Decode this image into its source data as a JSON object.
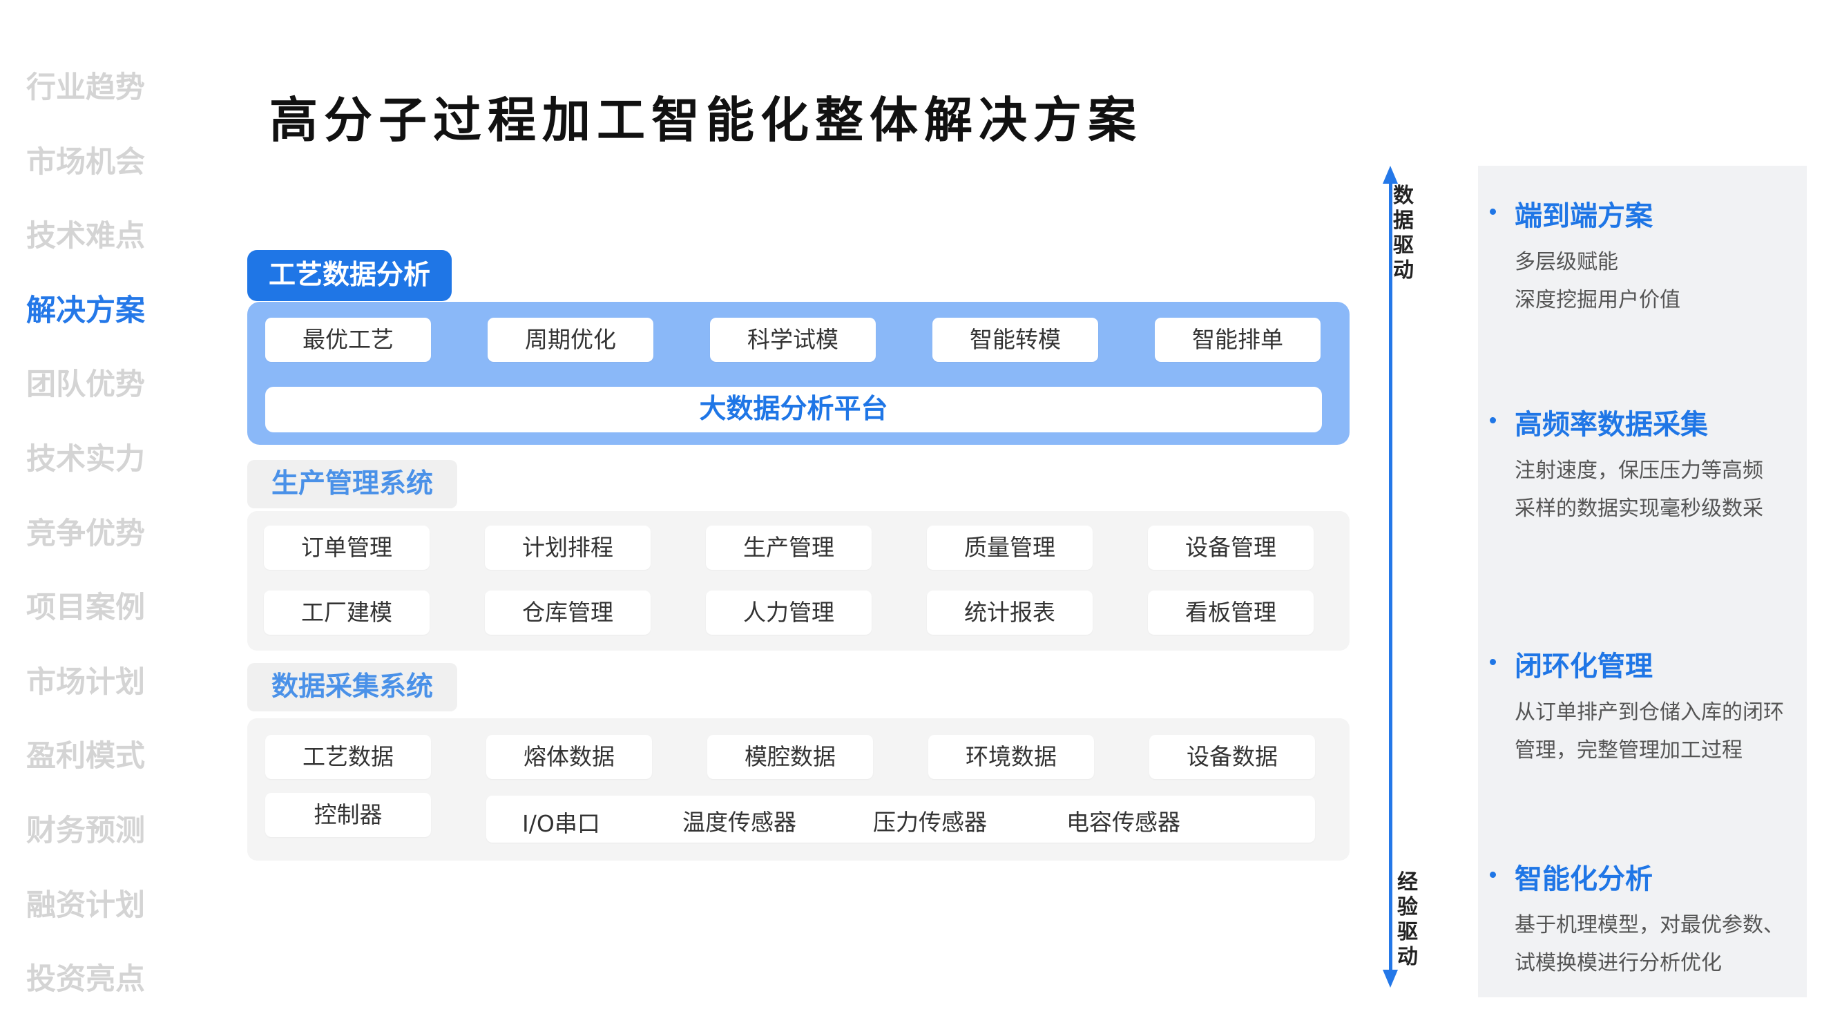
{
  "nav": {
    "items": [
      {
        "label": "行业趋势",
        "active": false
      },
      {
        "label": "市场机会",
        "active": false
      },
      {
        "label": "技术难点",
        "active": false
      },
      {
        "label": "解决方案",
        "active": true
      },
      {
        "label": "团队优势",
        "active": false
      },
      {
        "label": "技术实力",
        "active": false
      },
      {
        "label": "竞争优势",
        "active": false
      },
      {
        "label": "项目案例",
        "active": false
      },
      {
        "label": "市场计划",
        "active": false
      },
      {
        "label": "盈利模式",
        "active": false
      },
      {
        "label": "财务预测",
        "active": false
      },
      {
        "label": "融资计划",
        "active": false
      },
      {
        "label": "投资亮点",
        "active": false
      }
    ]
  },
  "title": "高分子过程加工智能化整体解决方案",
  "process": {
    "label": "工艺数据分析",
    "items": [
      "最优工艺",
      "周期优化",
      "科学试模",
      "智能转模",
      "智能排单"
    ],
    "platform": "大数据分析平台"
  },
  "production": {
    "label": "生产管理系统",
    "row1": [
      "订单管理",
      "计划排程",
      "生产管理",
      "质量管理",
      "设备管理"
    ],
    "row2": [
      "工厂建模",
      "仓库管理",
      "人力管理",
      "统计报表",
      "看板管理"
    ]
  },
  "collection": {
    "label": "数据采集系统",
    "row1": [
      "工艺数据",
      "熔体数据",
      "模腔数据",
      "环境数据",
      "设备数据"
    ],
    "controller": "控制器",
    "interfaces": [
      "I/O串口",
      "温度传感器",
      "压力传感器",
      "电容传感器"
    ]
  },
  "axis": {
    "top": "数据驱动",
    "bottom": "经验驱动"
  },
  "features": [
    {
      "title": "端到端方案",
      "lines": [
        "多层级赋能",
        "深度挖掘用户价值"
      ]
    },
    {
      "title": "高频率数据采集",
      "lines": [
        "注射速度，保压压力等高频",
        "采样的数据实现毫秒级数采"
      ]
    },
    {
      "title": "闭环化管理",
      "lines": [
        "从订单排产到仓储入库的闭环",
        "管理，完整管理加工过程"
      ]
    },
    {
      "title": "智能化分析",
      "lines": [
        "基于机理模型，对最优参数、",
        "试模换模进行分析优化"
      ]
    }
  ],
  "colors": {
    "accent": "#1f76e6",
    "panel_blue": "#8ab8f8",
    "panel_grey": "#f4f4f4",
    "nav_inactive": "#d4d4d4"
  }
}
